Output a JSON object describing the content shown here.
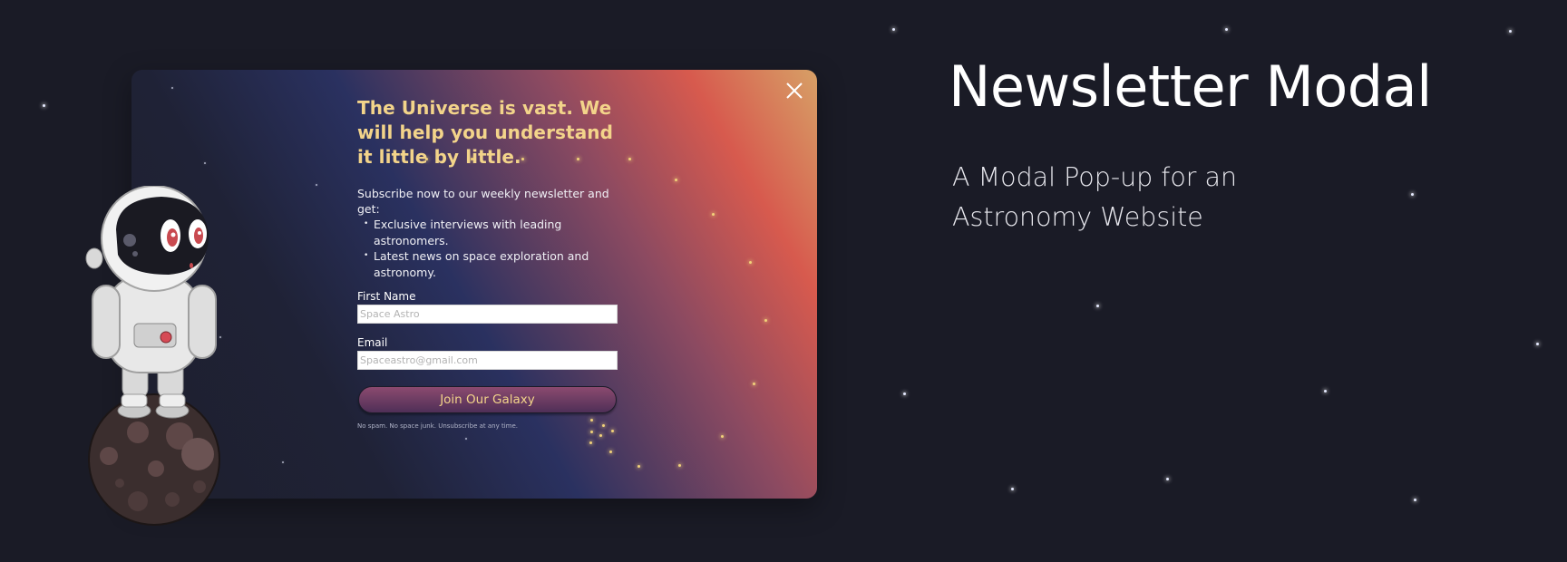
{
  "hero": {
    "title": "Newsletter Modal",
    "subtitle": "A Modal Pop-up for an Astronomy Website"
  },
  "modal": {
    "headline": "The Universe is vast. We will help you understand it little by little.",
    "intro": "Subscribe now to our weekly newsletter and get:",
    "perks": [
      "Exclusive interviews with leading astronomers.",
      "Latest news on space exploration and astronomy."
    ],
    "first_name": {
      "label": "First Name",
      "placeholder": "Space Astro",
      "value": ""
    },
    "email": {
      "label": "Email",
      "placeholder": "Spaceastro@gmail.com",
      "value": ""
    },
    "join_label": "Join Our Galaxy",
    "disclaimer": "No spam. No space junk. Unsubscribe at any time."
  },
  "icons": {
    "close": "close-icon",
    "astronaut": "astronaut-illustration",
    "moon": "moon-illustration"
  },
  "colors": {
    "background": "#1a1b26",
    "headline": "#f3d48a",
    "gradient_warm": "#d75a4e",
    "gradient_cool": "#2a3160"
  }
}
